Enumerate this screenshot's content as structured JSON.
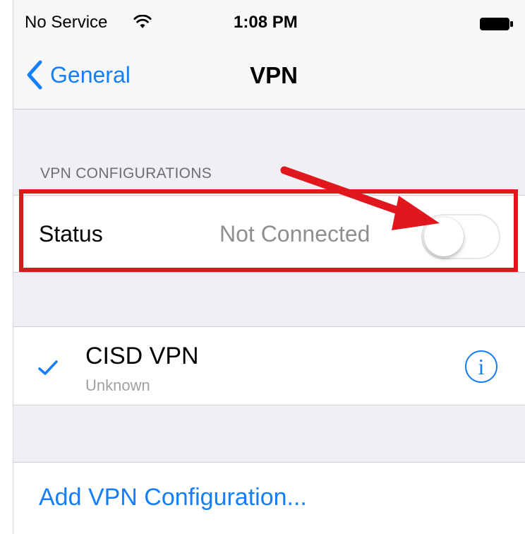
{
  "status_bar": {
    "carrier": "No Service",
    "time": "1:08 PM",
    "wifi_icon": "wifi-icon",
    "battery_icon": "battery-icon"
  },
  "nav": {
    "back_label": "General",
    "title": "VPN"
  },
  "configurations": {
    "header": "VPN CONFIGURATIONS",
    "status_label": "Status",
    "status_value": "Not Connected",
    "toggle_on": false
  },
  "vpn_profiles": [
    {
      "name": "CISD VPN",
      "subtitle": "Unknown",
      "selected": true,
      "info_glyph": "i"
    }
  ],
  "add_config_label": "Add VPN Configuration...",
  "colors": {
    "accent": "#157efb",
    "annotation_red": "#e0171d",
    "background": "#efeff4",
    "secondary_text": "#8e8e93"
  }
}
